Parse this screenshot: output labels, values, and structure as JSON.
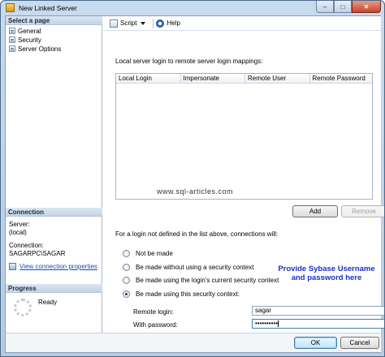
{
  "window": {
    "title": "New Linked Server",
    "minimize_glyph": "–",
    "maximize_glyph": "□",
    "close_glyph": "✕"
  },
  "sidebar": {
    "select_page_header": "Select a page",
    "pages": [
      {
        "label": "General",
        "icon": "page-icon"
      },
      {
        "label": "Security",
        "icon": "page-icon"
      },
      {
        "label": "Server Options",
        "icon": "page-icon"
      }
    ],
    "connection_header": "Connection",
    "server_label": "Server:",
    "server_value": "(local)",
    "connection_label": "Connection:",
    "connection_value": "SAGARPC\\SAGAR",
    "view_connection_link": "View connection properties",
    "progress_header": "Progress",
    "progress_status": "Ready"
  },
  "toolbar": {
    "script_label": "Script",
    "help_label": "Help"
  },
  "security": {
    "mappings_description": "Local server login to remote server login mappings:",
    "columns": [
      "Local Login",
      "Impersonate",
      "Remote User",
      "Remote Password"
    ],
    "rows": [],
    "watermark": "www.sql-articles.com",
    "add_label": "Add",
    "remove_label": "Remove",
    "unmapped_note": "For a login not defined in the list above, connections will:",
    "options": [
      {
        "label": "Not be made",
        "checked": false
      },
      {
        "label": "Be made without using a security context",
        "checked": false
      },
      {
        "label": "Be made using the login's current security context",
        "checked": false
      },
      {
        "label": "Be made using this security context:",
        "checked": true
      }
    ],
    "remote_login_label": "Remote login:",
    "remote_login_value": "sagar",
    "password_label": "With password:",
    "password_value": "••••••••••",
    "callout": "Provide Sybase Username and password here"
  },
  "footer": {
    "ok_label": "OK",
    "cancel_label": "Cancel"
  },
  "colors": {
    "callout": "#1a2fd0",
    "link": "#1a4fa3"
  }
}
